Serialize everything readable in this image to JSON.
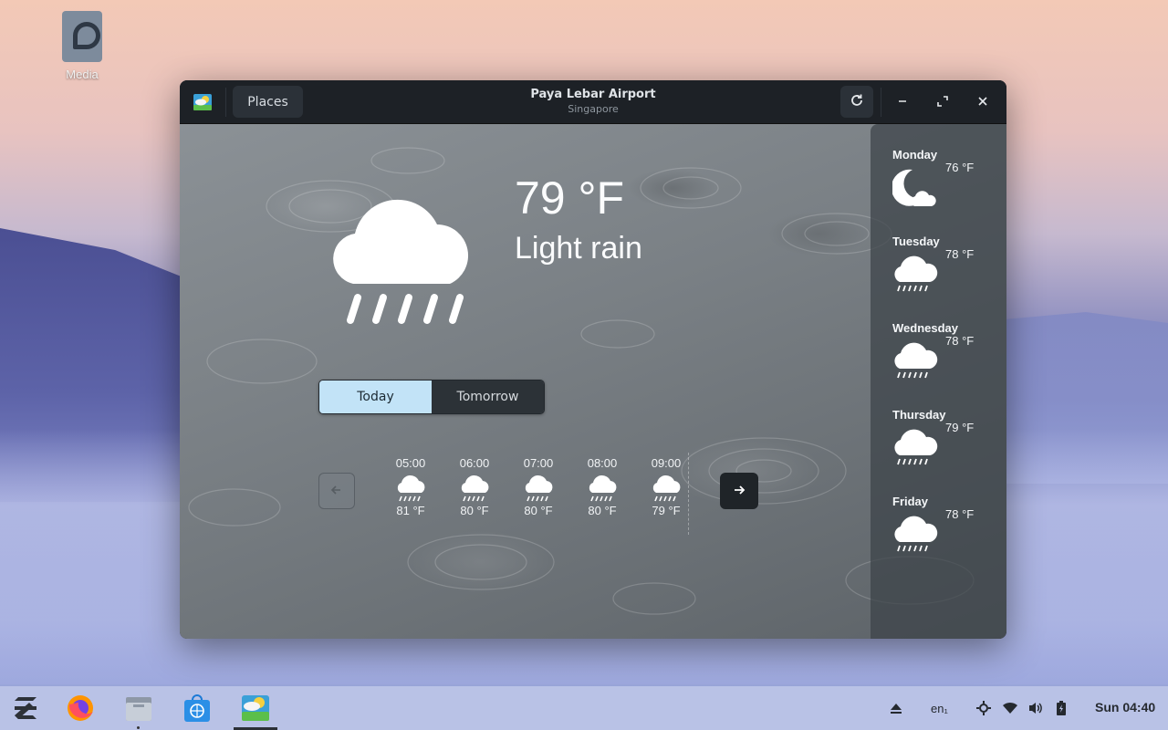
{
  "desktop": {
    "icon_label": "Media"
  },
  "window": {
    "title": "Paya Lebar Airport",
    "subtitle": "Singapore",
    "places_label": "Places"
  },
  "current": {
    "temperature": "79 °F",
    "condition": "Light rain"
  },
  "toggle": {
    "today": "Today",
    "tomorrow": "Tomorrow"
  },
  "hourly": [
    {
      "time": "05:00",
      "temp": "81 °F",
      "icon": "light-rain-icon"
    },
    {
      "time": "06:00",
      "temp": "80 °F",
      "icon": "light-rain-icon"
    },
    {
      "time": "07:00",
      "temp": "80 °F",
      "icon": "light-rain-icon"
    },
    {
      "time": "08:00",
      "temp": "80 °F",
      "icon": "light-rain-icon"
    },
    {
      "time": "09:00",
      "temp": "79 °F",
      "icon": "light-rain-icon"
    }
  ],
  "forecast": [
    {
      "day": "Monday",
      "temp": "76 °F",
      "icon": "night-cloud-icon"
    },
    {
      "day": "Tuesday",
      "temp": "78 °F",
      "icon": "rain-icon"
    },
    {
      "day": "Wednesday",
      "temp": "78 °F",
      "icon": "rain-icon"
    },
    {
      "day": "Thursday",
      "temp": "79 °F",
      "icon": "rain-icon"
    },
    {
      "day": "Friday",
      "temp": "78 °F",
      "icon": "rain-icon"
    }
  ],
  "taskbar": {
    "apps": [
      "zorin-menu-icon",
      "firefox-icon",
      "files-icon",
      "software-store-icon",
      "weather-app-icon"
    ],
    "keyboard_layout": "en₁",
    "clock": "Sun 04:40"
  }
}
